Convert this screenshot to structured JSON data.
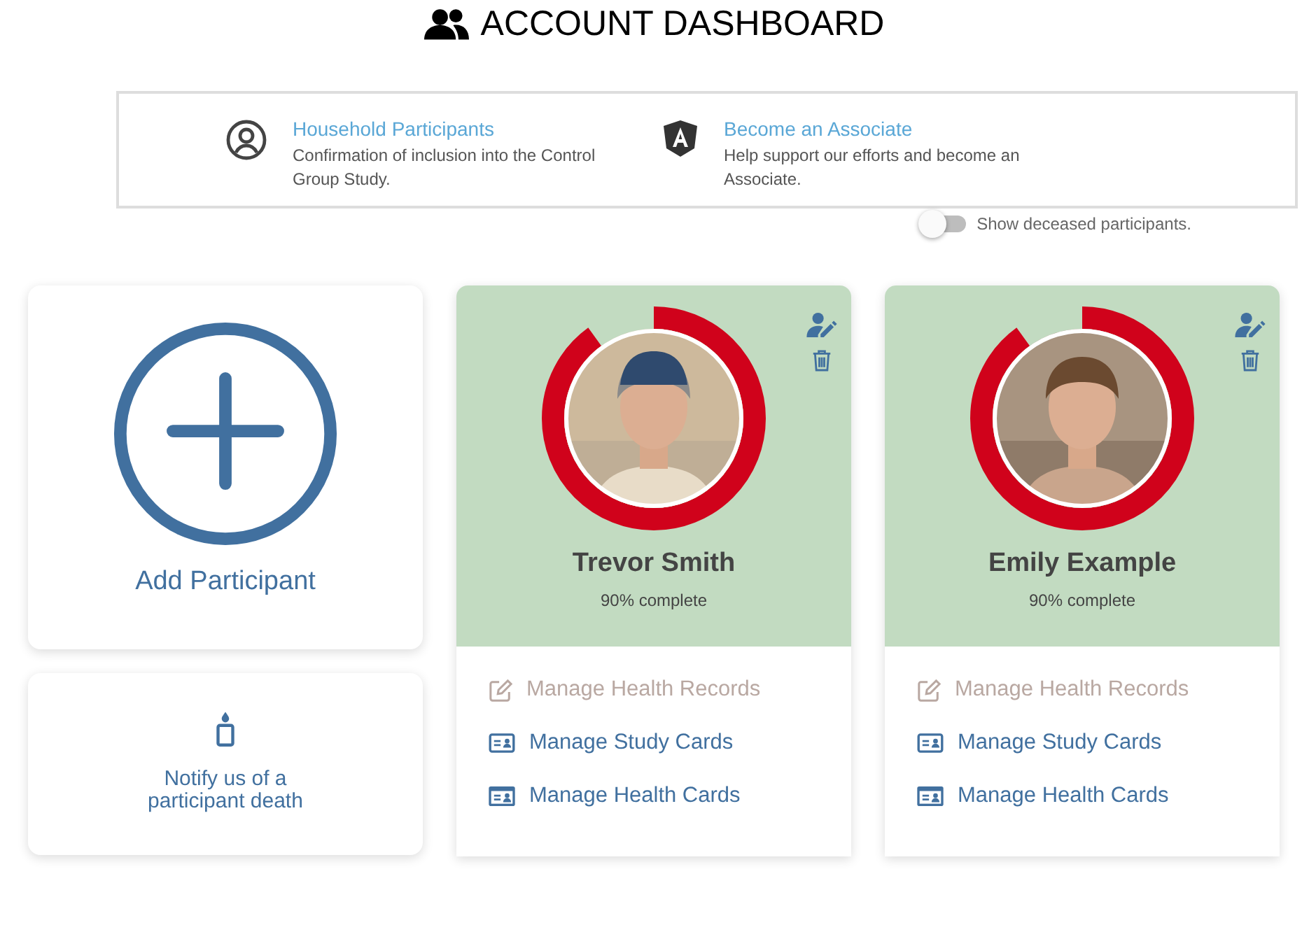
{
  "title": "ACCOUNT DASHBOARD",
  "info_links": [
    {
      "kind": "person",
      "title": "Household Participants",
      "description": "Confirmation of inclusion into the Control Group Study."
    },
    {
      "kind": "shield",
      "title": "Become an Associate",
      "description": "Help support our efforts and become an Associate."
    }
  ],
  "deceased_toggle": {
    "label": "Show deceased participants.",
    "on": false
  },
  "add_card": {
    "label": "Add Participant"
  },
  "notify_card": {
    "label": "Notify us of a participant death"
  },
  "participants": [
    {
      "name": "Trevor Smith",
      "progress_text": "90% complete",
      "level": 0.9,
      "actions": [
        {
          "kind": "records",
          "label": "Manage Health Records",
          "disabled": true
        },
        {
          "kind": "study",
          "label": "Manage Study Cards",
          "disabled": false
        },
        {
          "kind": "health",
          "label": "Manage Health Cards",
          "disabled": false
        }
      ]
    },
    {
      "name": "Emily Example",
      "progress_text": "90% complete",
      "level": 0.9,
      "actions": [
        {
          "kind": "records",
          "label": "Manage Health Records",
          "disabled": true
        },
        {
          "kind": "study",
          "label": "Manage Study Cards",
          "disabled": false
        },
        {
          "kind": "health",
          "label": "Manage Health Cards",
          "disabled": false
        }
      ]
    }
  ]
}
